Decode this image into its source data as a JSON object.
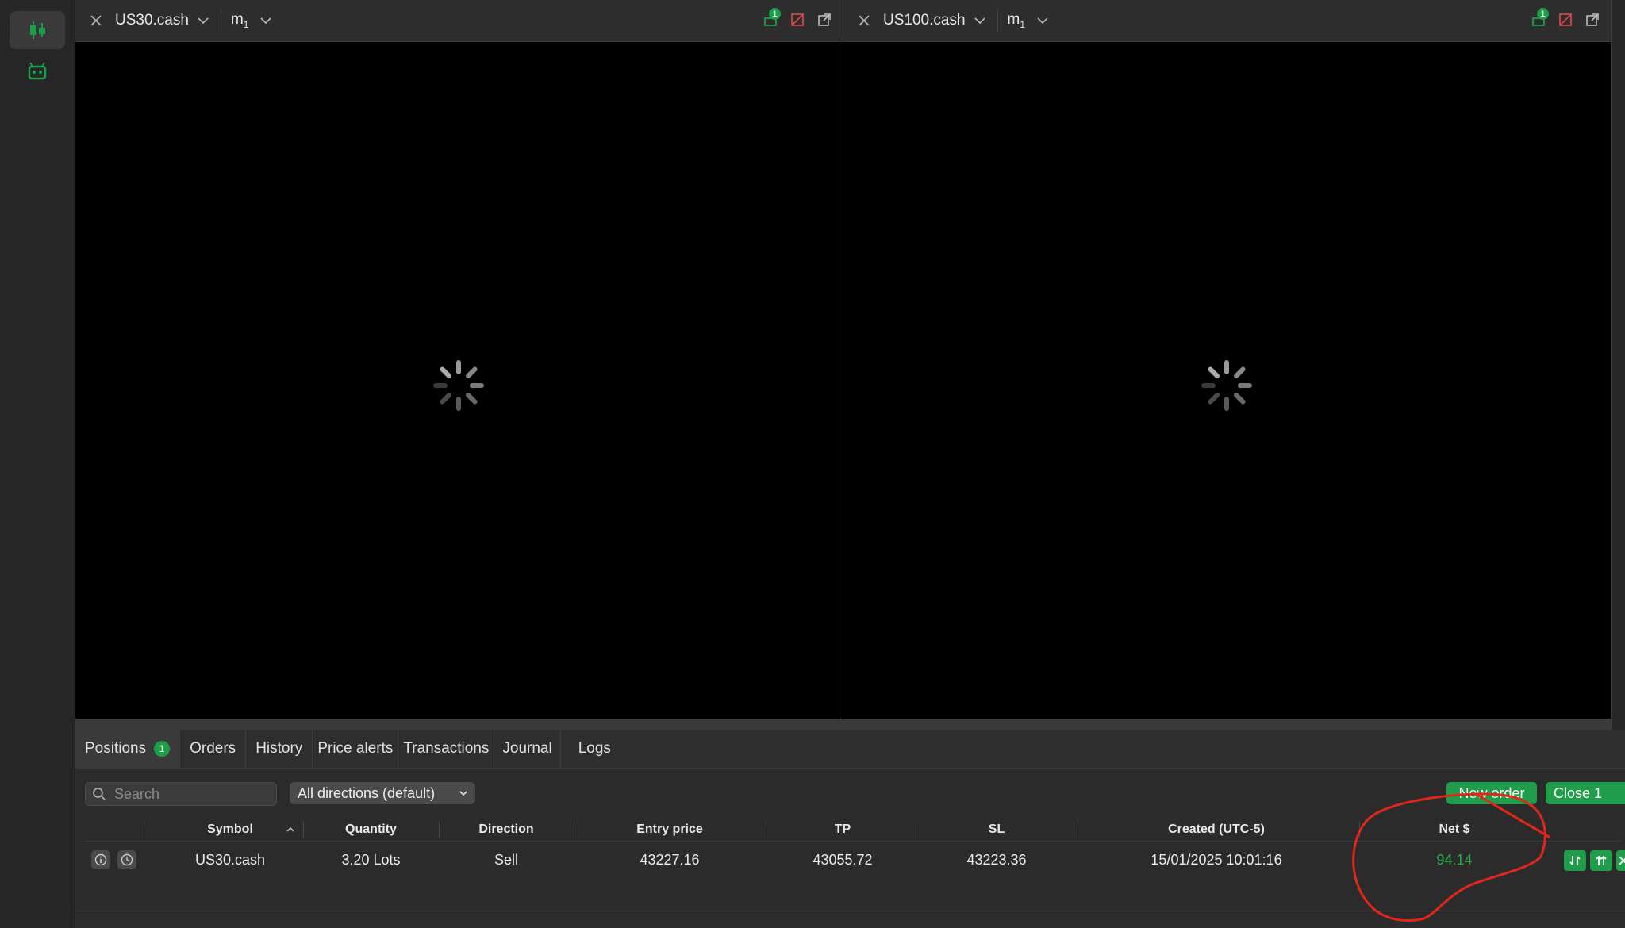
{
  "charts": [
    {
      "symbol": "US30.cash",
      "timeframe": "m",
      "timeframe_sub": "1",
      "alerts_count": "1"
    },
    {
      "symbol": "US100.cash",
      "timeframe": "m",
      "timeframe_sub": "1",
      "alerts_count": "1"
    }
  ],
  "bottom_tabs": [
    {
      "label": "Positions",
      "badge": "1"
    },
    {
      "label": "Orders"
    },
    {
      "label": "History"
    },
    {
      "label": "Price alerts"
    },
    {
      "label": "Transactions"
    },
    {
      "label": "Journal"
    },
    {
      "label": "Logs"
    }
  ],
  "toolbar": {
    "search_placeholder": "Search",
    "direction_filter": "All directions (default)",
    "new_order_label": "New order",
    "close_label": "Close 1"
  },
  "table": {
    "headers": [
      "Symbol",
      "Quantity",
      "Direction",
      "Entry price",
      "TP",
      "SL",
      "Created (UTC-5)",
      "Net $"
    ],
    "rows": [
      {
        "symbol": "US30.cash",
        "quantity": "3.20 Lots",
        "direction": "Sell",
        "entry_price": "43227.16",
        "tp": "43055.72",
        "sl": "43223.36",
        "created": "15/01/2025 10:01:16",
        "net": "94.14"
      }
    ]
  },
  "colors": {
    "accent_green": "#1f9d4a",
    "net_positive": "#2aa84f",
    "annotation_red": "#e3261b"
  }
}
